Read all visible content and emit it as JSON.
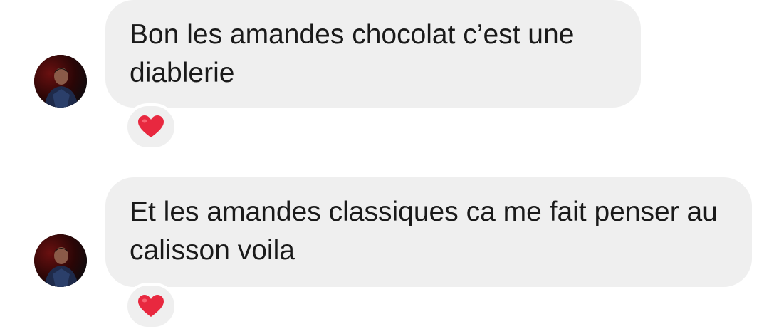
{
  "messages": [
    {
      "text": "Bon les amandes chocolat c’est une diablerie",
      "reaction": "heart-icon"
    },
    {
      "text": "Et les amandes classiques ca me fait penser au calisson voila",
      "reaction": "heart-icon"
    }
  ],
  "colors": {
    "bubble": "#efefef",
    "text": "#1a1a1a",
    "heart": "#e8283f"
  }
}
